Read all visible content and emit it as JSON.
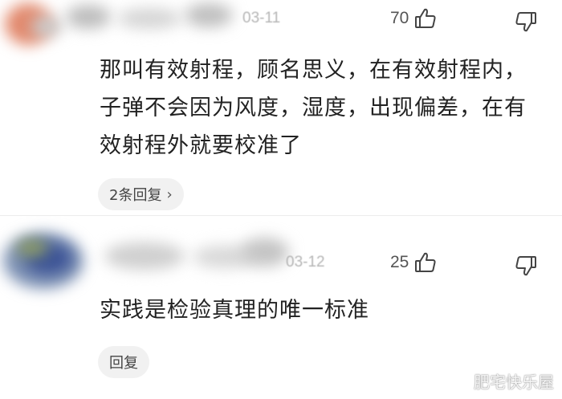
{
  "comments": [
    {
      "date": "03-11",
      "likes": "70",
      "text": "那叫有效射程，顾名思义，在有效射程内，子弹不会因为风度，湿度，出现偏差，在有效射程外就要校准了",
      "replies_label": "2条回复",
      "reply_chevron": "›"
    },
    {
      "date": "03-12",
      "likes": "25",
      "text": "实践是检验真理的唯一标准",
      "reply_label": "回复"
    }
  ],
  "icons": {
    "like": "thumbs-up-icon",
    "dislike": "thumbs-down-icon"
  },
  "colors": {
    "background": "#ffffff",
    "text": "#222222",
    "pill": "#f1f1f1",
    "muted": "#b5b5b5"
  },
  "watermark": "肥宅快乐屋"
}
